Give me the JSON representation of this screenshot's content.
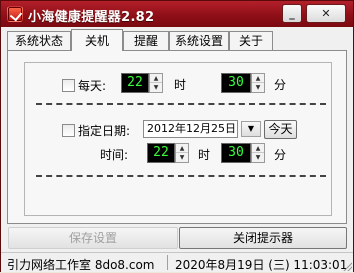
{
  "window": {
    "title": "小海健康提醒器2.82",
    "minimize_label": "_",
    "close_label": "✕"
  },
  "tabs": [
    {
      "label": "系统状态",
      "active": false
    },
    {
      "label": "关机",
      "active": true
    },
    {
      "label": "提醒",
      "active": false
    },
    {
      "label": "系统设置",
      "active": false
    },
    {
      "label": "关于",
      "active": false
    }
  ],
  "daily": {
    "checked": false,
    "label": "每天:",
    "hour": "22",
    "hour_unit": "时",
    "minute": "30",
    "minute_unit": "分"
  },
  "specific": {
    "checked": false,
    "label": "指定日期:",
    "date": "2012年12月25日",
    "today_label": "今天",
    "time_label": "时间:",
    "hour": "22",
    "hour_unit": "时",
    "minute": "30",
    "minute_unit": "分"
  },
  "buttons": {
    "save_label": "保存设置",
    "close_tip_label": "关闭提示器"
  },
  "status": {
    "left": "引力网络工作室 8do8.com",
    "right": "2020年8月19日 (三) 11:03:01"
  },
  "icons": {
    "app": "heart-check-icon",
    "spin_up": "triangle-up-icon",
    "spin_down": "triangle-down-icon",
    "dropdown": "chevron-down-icon"
  },
  "colors": {
    "titlebar": "#8f0f18",
    "spin_bg": "#000000",
    "spin_text": "#38ff3b"
  }
}
